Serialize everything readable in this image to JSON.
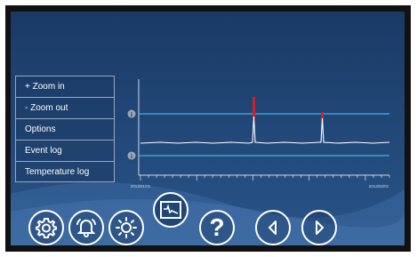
{
  "menu": {
    "items": [
      {
        "label": "+ Zoom in"
      },
      {
        "label": "-  Zoom out"
      },
      {
        "label": "Options"
      },
      {
        "label": "Event log"
      },
      {
        "label": "Temperature log"
      }
    ]
  },
  "chart": {
    "info_marker": "i",
    "x_start_label": "2013/01/01",
    "x_end_label": "2013/02/01",
    "colors": {
      "limit_line": "#3fb0e6",
      "trace": "#ffffff",
      "spike": "#d0202c"
    }
  },
  "toolbar": {
    "icons": [
      "settings-icon",
      "alarm-bell-icon",
      "brightness-icon",
      "graph-icon",
      "help-icon",
      "arrow-left-icon",
      "arrow-right-icon"
    ],
    "help_glyph": "?"
  }
}
